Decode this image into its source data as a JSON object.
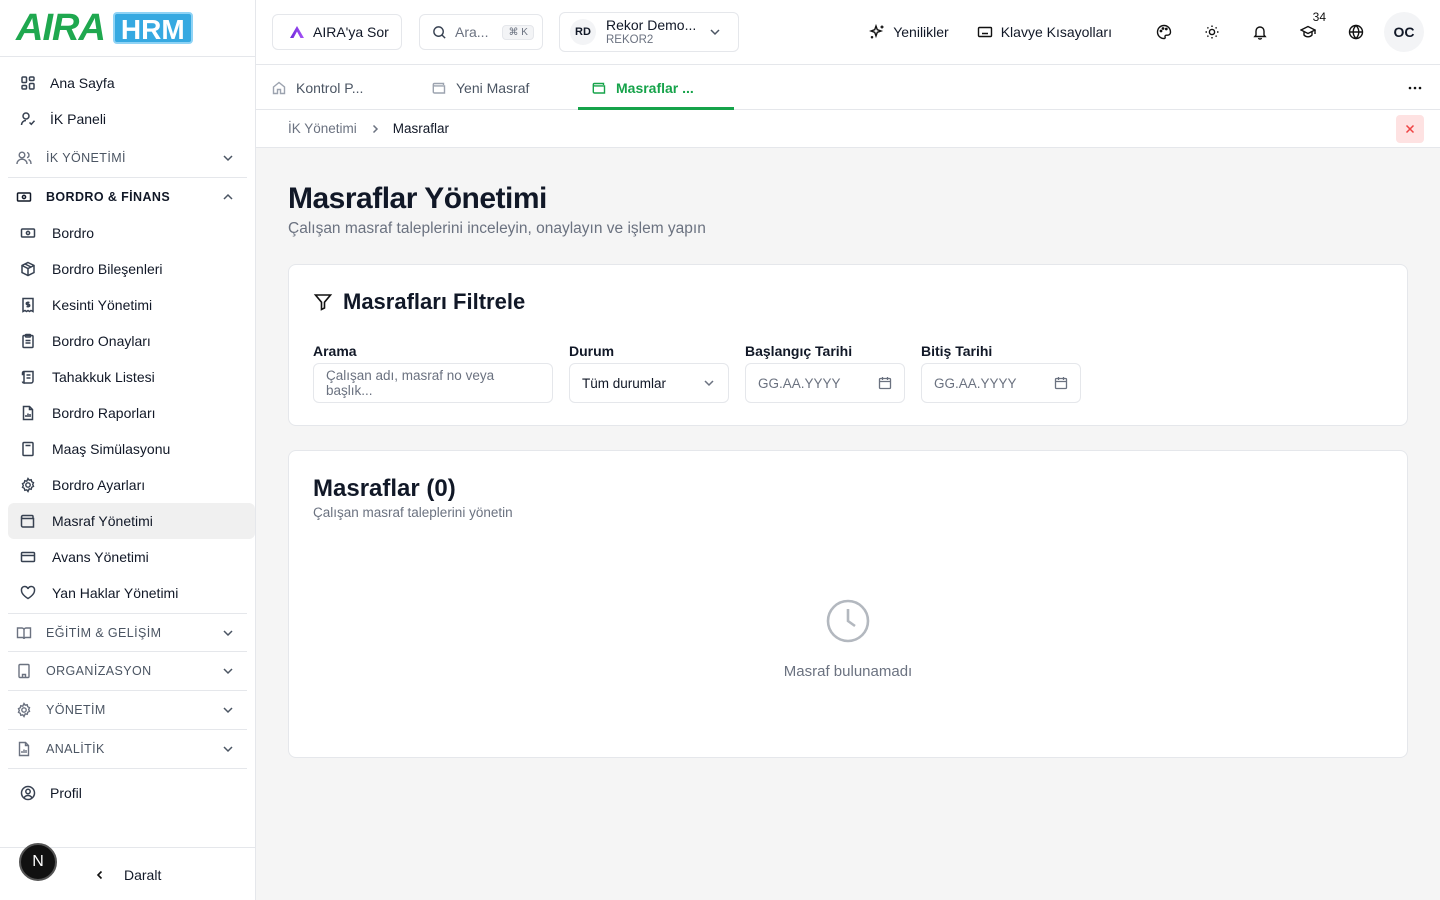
{
  "brand": {
    "logo_text": "AIRA",
    "logo_suffix": "HRM"
  },
  "sidebar": {
    "top_items": [
      {
        "label": "Ana Sayfa",
        "icon": "grid-icon"
      },
      {
        "label": "İK Paneli",
        "icon": "user-check-icon"
      }
    ],
    "sections": [
      {
        "label": "İK YÖNETİMİ",
        "icon": "users-icon",
        "expanded": false
      },
      {
        "label": "BORDRO & FİNANS",
        "icon": "banknote-icon",
        "expanded": true
      },
      {
        "label": "EĞİTİM & GELİŞİM",
        "icon": "book-icon",
        "expanded": false
      },
      {
        "label": "ORGANİZASYON",
        "icon": "building-icon",
        "expanded": false
      },
      {
        "label": "YÖNETİM",
        "icon": "gear-icon",
        "expanded": false
      },
      {
        "label": "ANALİTİK",
        "icon": "report-icon",
        "expanded": false
      }
    ],
    "finance_items": [
      {
        "label": "Bordro",
        "icon": "banknote-icon"
      },
      {
        "label": "Bordro Bileşenleri",
        "icon": "package-icon"
      },
      {
        "label": "Kesinti Yönetimi",
        "icon": "receipt-dollar-icon"
      },
      {
        "label": "Bordro Onayları",
        "icon": "clipboard-icon"
      },
      {
        "label": "Tahakkuk Listesi",
        "icon": "scroll-icon"
      },
      {
        "label": "Bordro Raporları",
        "icon": "file-chart-icon"
      },
      {
        "label": "Maaş Simülasyonu",
        "icon": "calculator-icon"
      },
      {
        "label": "Bordro Ayarları",
        "icon": "gear-icon"
      },
      {
        "label": "Masraf Yönetimi",
        "icon": "wallet-icon",
        "active": true
      },
      {
        "label": "Avans Yönetimi",
        "icon": "credit-card-icon"
      },
      {
        "label": "Yan Haklar Yönetimi",
        "icon": "heart-icon"
      }
    ],
    "profile": "Profil",
    "collapse_label": "Daralt",
    "n_badge": "N"
  },
  "topbar": {
    "ask_aira": "AIRA'ya Sor",
    "search_placeholder": "Ara...",
    "search_shortcut": "⌘ K",
    "company_initials": "RD",
    "company_name": "Rekor Demo...",
    "company_code": "REKOR2",
    "whats_new": "Yenilikler",
    "shortcuts": "Klavye Kısayolları",
    "training_count": "34",
    "user_initials": "OC"
  },
  "tabs": [
    {
      "label": "Kontrol P...",
      "icon": "home-icon",
      "active": false
    },
    {
      "label": "Yeni Masraf",
      "icon": "wallet-icon",
      "active": false
    },
    {
      "label": "Masraflar ...",
      "icon": "wallet-icon",
      "active": true
    }
  ],
  "breadcrumb": {
    "parent": "İK Yönetimi",
    "current": "Masraflar"
  },
  "page": {
    "title": "Masraflar Yönetimi",
    "subtitle": "Çalışan masraf taleplerini inceleyin, onaylayın ve işlem yapın"
  },
  "filters": {
    "title": "Masrafları Filtrele",
    "search_label": "Arama",
    "search_placeholder": "Çalışan adı, masraf no veya başlık...",
    "status_label": "Durum",
    "status_value": "Tüm durumlar",
    "start_label": "Başlangıç Tarihi",
    "start_placeholder": "GG.AA.YYYY",
    "end_label": "Bitiş Tarihi",
    "end_placeholder": "GG.AA.YYYY"
  },
  "list": {
    "title": "Masraflar (0)",
    "subtitle": "Çalışan masraf taleplerini yönetin",
    "empty_text": "Masraf bulunamadı"
  },
  "colors": {
    "accent": "#16a34a",
    "brand_green": "#1fa84f",
    "brand_blue": "#36a9e1",
    "danger": "#ef4444"
  }
}
